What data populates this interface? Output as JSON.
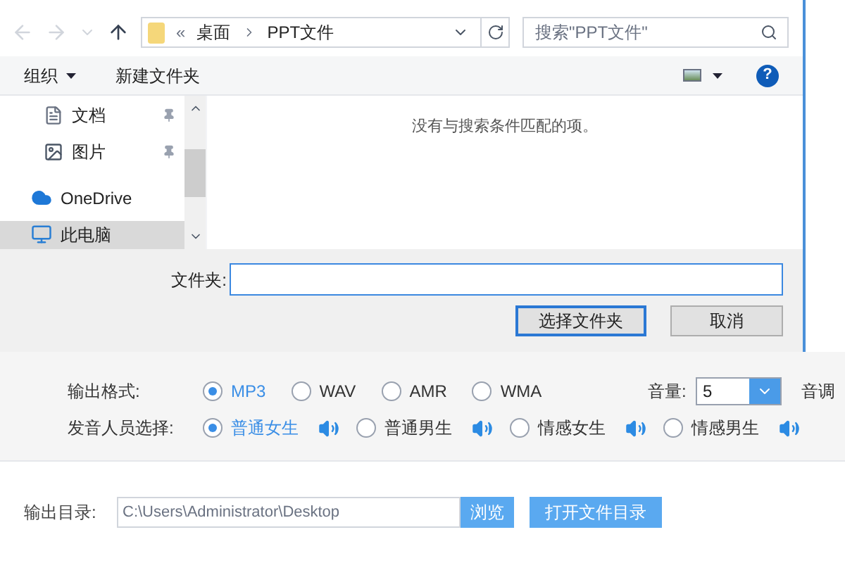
{
  "dialog": {
    "breadcrumb": [
      "«",
      "桌面",
      "PPT文件"
    ],
    "search": {
      "placeholder": "搜索\"PPT文件\""
    },
    "toolbar": {
      "organize": "组织",
      "new_folder": "新建文件夹",
      "help": "?"
    },
    "sidebar": {
      "items": [
        {
          "label": "文档",
          "kind": "document",
          "pinned": true,
          "selected": false
        },
        {
          "label": "图片",
          "kind": "image",
          "pinned": true,
          "selected": false
        },
        {
          "label": "OneDrive",
          "kind": "cloud",
          "pinned": false,
          "selected": false
        },
        {
          "label": "此电脑",
          "kind": "computer",
          "pinned": false,
          "selected": true
        }
      ]
    },
    "empty_message": "没有与搜索条件匹配的项。",
    "folder_label": "文件夹:",
    "buttons": [
      {
        "label": "选择文件夹",
        "default": true
      },
      {
        "label": "取消",
        "default": false
      }
    ]
  },
  "settings": {
    "format": {
      "label": "输出格式:",
      "options": [
        {
          "label": "MP3",
          "selected": true
        },
        {
          "label": "WAV",
          "selected": false
        },
        {
          "label": "AMR",
          "selected": false
        },
        {
          "label": "WMA",
          "selected": false
        }
      ]
    },
    "volume": {
      "label": "音量:",
      "value": "5"
    },
    "pitch_label": "音调",
    "voice": {
      "label": "发音人员选择:",
      "options": [
        {
          "label": "普通女生",
          "selected": true
        },
        {
          "label": "普通男生",
          "selected": false
        },
        {
          "label": "情感女生",
          "selected": false
        },
        {
          "label": "情感男生",
          "selected": false
        }
      ]
    },
    "output": {
      "label": "输出目录:",
      "value": "C:\\Users\\Administrator\\Desktop",
      "browse": "浏览",
      "open": "打开文件目录"
    }
  }
}
